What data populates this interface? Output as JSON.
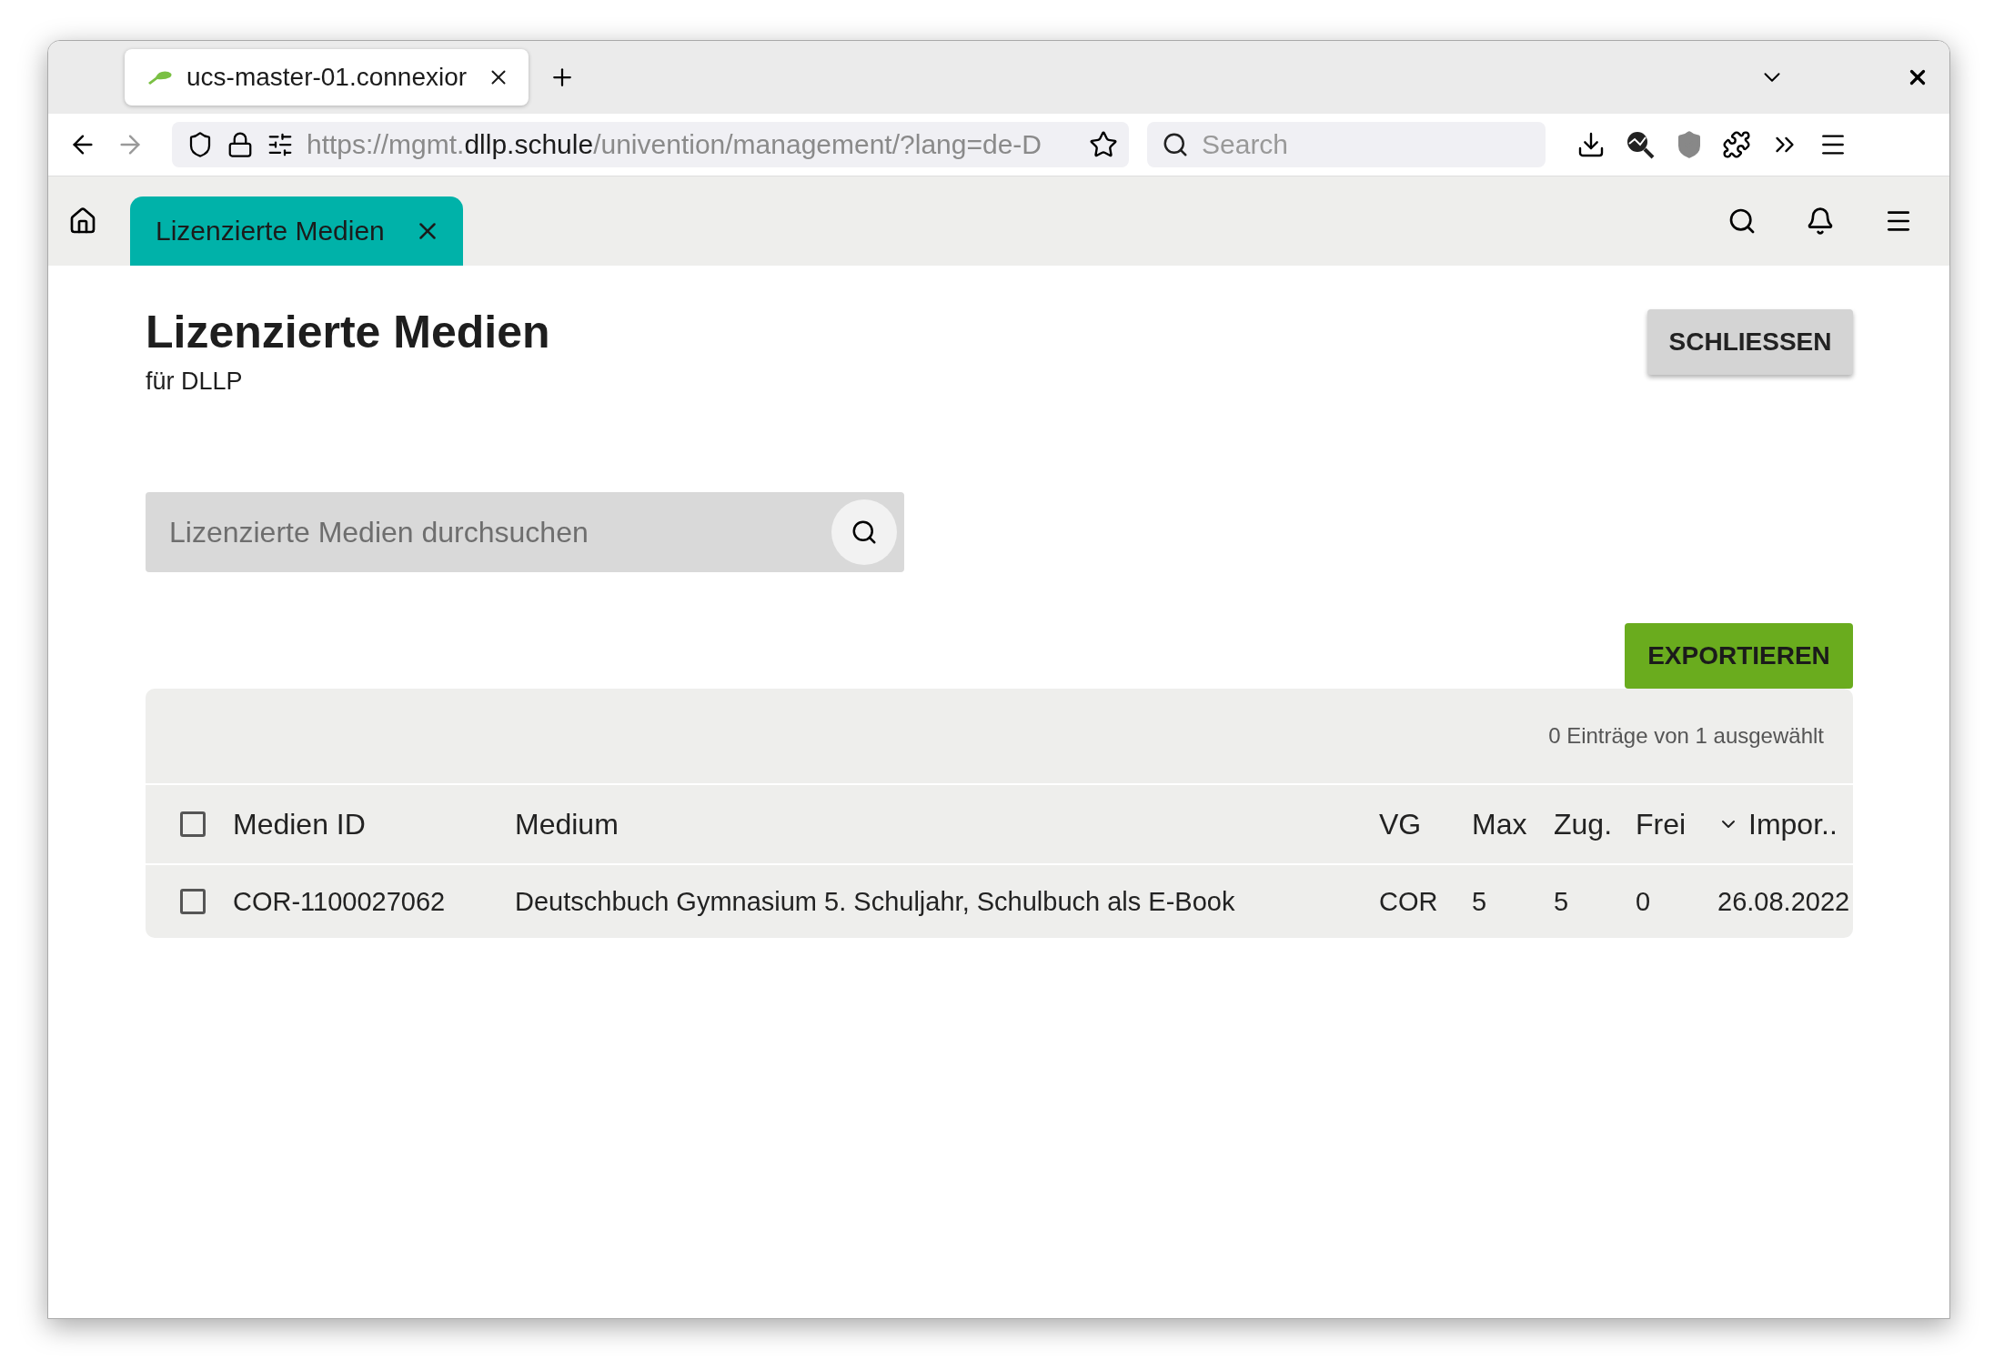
{
  "browser": {
    "tabs": [
      {
        "title": "ucs-master-01.connexior",
        "selected": true
      }
    ],
    "url": {
      "prefix": "https://mgmt.",
      "domain": "dllp.schule",
      "path": "/univention/management/?lang=de-D"
    },
    "search": {
      "placeholder": "Search"
    }
  },
  "app_tabs": [
    {
      "label": "Lizenzierte Medien",
      "selected": true
    }
  ],
  "page": {
    "title": "Lizenzierte Medien",
    "subtitle": "für DLLP",
    "close_button": "SCHLIESSEN"
  },
  "search": {
    "placeholder": "Lizenzierte Medien durchsuchen"
  },
  "export_button": "EXPORTIEREN",
  "table": {
    "status": "0 Einträge von 1 ausgewählt",
    "all_checked": false,
    "columns": [
      {
        "label": "Medien ID",
        "sorted": false
      },
      {
        "label": "Medium",
        "sorted": false
      },
      {
        "label": "VG",
        "sorted": false
      },
      {
        "label": "Max",
        "sorted": false
      },
      {
        "label": "Zug.",
        "sorted": false
      },
      {
        "label": "Frei",
        "sorted": false
      },
      {
        "label": "Impor..",
        "sorted": true
      }
    ],
    "rows": [
      {
        "checked": false,
        "cells": [
          "COR-1100027062",
          "Deutschbuch Gymnasium 5. Schuljahr, Schulbuch als E-Book",
          "COR",
          "5",
          "5",
          "0",
          "26.08.2022"
        ]
      }
    ]
  }
}
